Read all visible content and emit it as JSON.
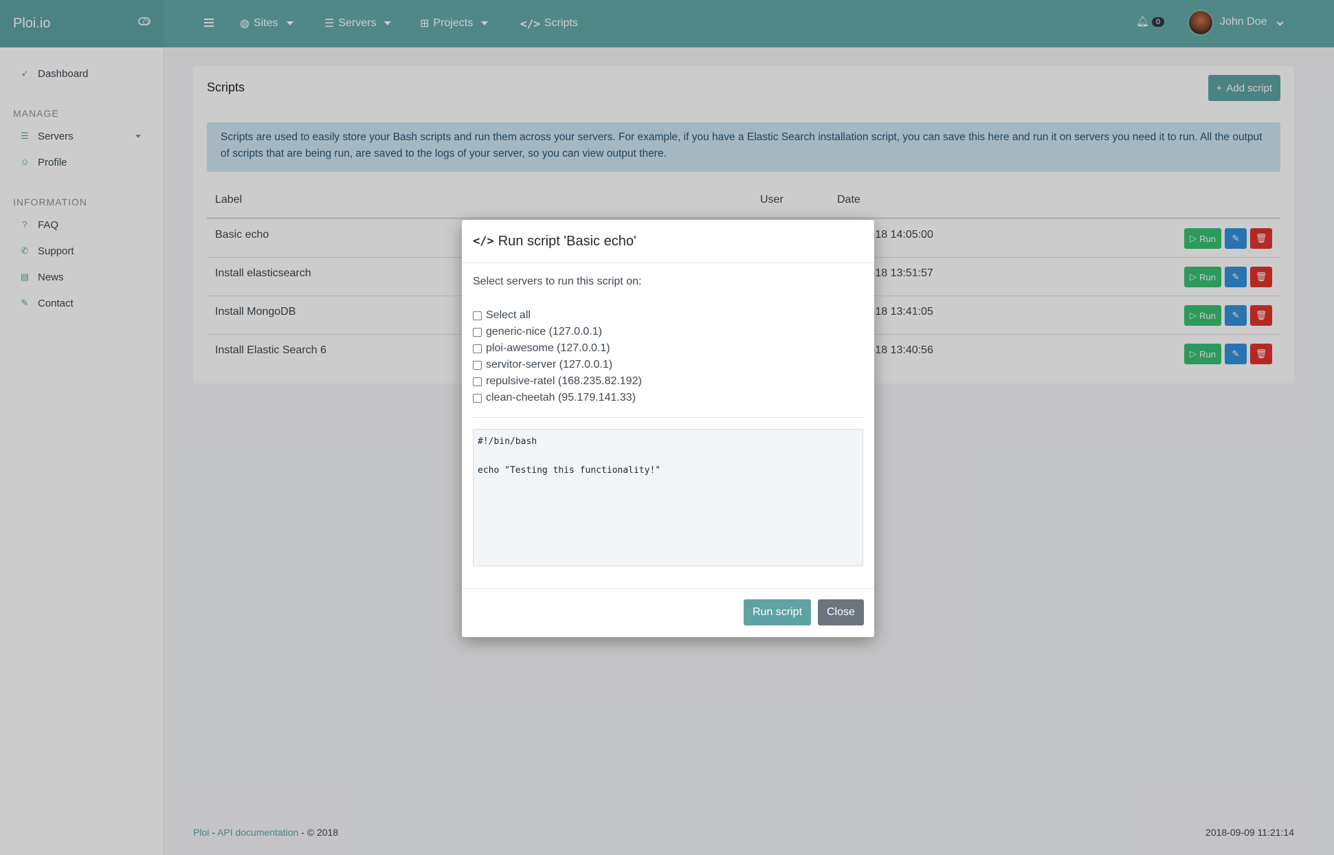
{
  "app": {
    "brand": "Ploi.io"
  },
  "topnav": {
    "items": [
      {
        "label": "Sites"
      },
      {
        "label": "Servers"
      },
      {
        "label": "Projects"
      },
      {
        "label": "Scripts"
      }
    ],
    "notifications_count": "0",
    "user_name": "John Doe"
  },
  "sidebar": {
    "dashboard": "Dashboard",
    "manage_heading": "Manage",
    "manage_items": [
      {
        "label": "Servers"
      },
      {
        "label": "Profile"
      }
    ],
    "info_heading": "Information",
    "info_items": [
      {
        "label": "FAQ"
      },
      {
        "label": "Support"
      },
      {
        "label": "News"
      },
      {
        "label": "Contact"
      }
    ]
  },
  "page": {
    "title": "Scripts",
    "add_button": "Add script",
    "info_text": "Scripts are used to easily store your Bash scripts and run them across your servers. For example, if you have a Elastic Search installation script, you can save this here and run it on servers you need it to run. All the output of scripts that are being run, are saved to the logs of your server, so you can view output there.",
    "table": {
      "headers": {
        "label": "Label",
        "user": "User",
        "date": "Date"
      },
      "rows": [
        {
          "label": "Basic echo",
          "date": "-18 14:05:00"
        },
        {
          "label": "Install elasticsearch",
          "date": "-18 13:51:57"
        },
        {
          "label": "Install MongoDB",
          "date": "-18 13:41:05"
        },
        {
          "label": "Install Elastic Search 6",
          "date": "-18 13:40:56"
        }
      ],
      "run_label": "Run"
    }
  },
  "modal": {
    "title": "Run script 'Basic echo'",
    "subtitle": "Select servers to run this script on:",
    "select_all": "Select all",
    "servers": [
      {
        "label": "generic-nice (127.0.0.1)"
      },
      {
        "label": "ploi-awesome (127.0.0.1)"
      },
      {
        "label": "servitor-server (127.0.0.1)"
      },
      {
        "label": "repulsive-ratel (168.235.82.192)"
      },
      {
        "label": "clean-cheetah (95.179.141.33)"
      }
    ],
    "script_content": "#!/bin/bash\n\necho \"Testing this functionality!\"",
    "run_button": "Run script",
    "close_button": "Close"
  },
  "footer": {
    "brand_link": "Ploi",
    "sep1": " - ",
    "api_link": "API documentation",
    "copyright": " - © 2018",
    "datetime": "2018-09-09 11:21:14"
  },
  "colors": {
    "accent": "#5ea3a3",
    "success": "#38c172",
    "info": "#3490dc",
    "danger": "#e3342f"
  }
}
